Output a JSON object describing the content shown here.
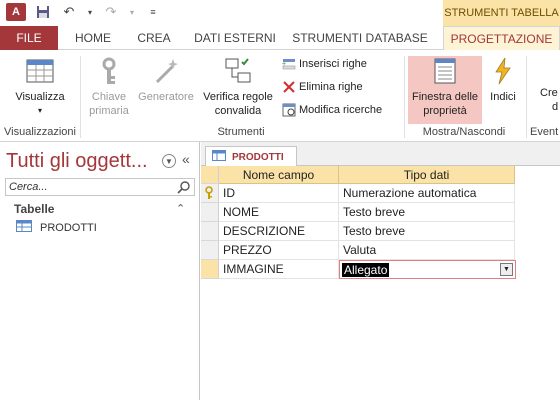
{
  "titlebar": {
    "app_logo_text": "A",
    "context_tools": "STRUMENTI TABELLA"
  },
  "ribbon_tabs": [
    {
      "label": "FILE"
    },
    {
      "label": "HOME"
    },
    {
      "label": "CREA"
    },
    {
      "label": "DATI ESTERNI"
    },
    {
      "label": "STRUMENTI DATABASE"
    },
    {
      "label": "PROGETTAZIONE"
    }
  ],
  "ribbon": {
    "visualizza": "Visualizza",
    "chiave_1": "Chiave",
    "chiave_2": "primaria",
    "generatore": "Generatore",
    "verifica_1": "Verifica regole",
    "verifica_2": "convalida",
    "inserisci_righe": "Inserisci righe",
    "elimina_righe": "Elimina righe",
    "modifica_ricerche": "Modifica ricerche",
    "finestra_1": "Finestra delle",
    "finestra_2": "proprietà",
    "indici": "Indici",
    "crea_partial_1": "Cre",
    "crea_partial_2": "d",
    "group_visualizzazioni": "Visualizzazioni",
    "group_strumenti": "Strumenti",
    "group_mostra": "Mostra/Nascondi",
    "group_eventi_partial": "Event"
  },
  "nav": {
    "title": "Tutti gli oggett...",
    "search_placeholder": "Cerca...",
    "group_label": "Tabelle",
    "items": [
      {
        "label": "PRODOTTI"
      }
    ]
  },
  "document": {
    "tab_label": "PRODOTTI",
    "columns": {
      "field": "Nome campo",
      "type": "Tipo dati"
    },
    "rows": [
      {
        "field": "ID",
        "type": "Numerazione automatica",
        "primary_key": true
      },
      {
        "field": "NOME",
        "type": "Testo breve"
      },
      {
        "field": "DESCRIZIONE",
        "type": "Testo breve"
      },
      {
        "field": "PREZZO",
        "type": "Valuta"
      },
      {
        "field": "IMMAGINE",
        "type": "Allegato",
        "active": true
      }
    ]
  },
  "colors": {
    "accent": "#a4373a",
    "context_tab": "#fbe3a7"
  }
}
